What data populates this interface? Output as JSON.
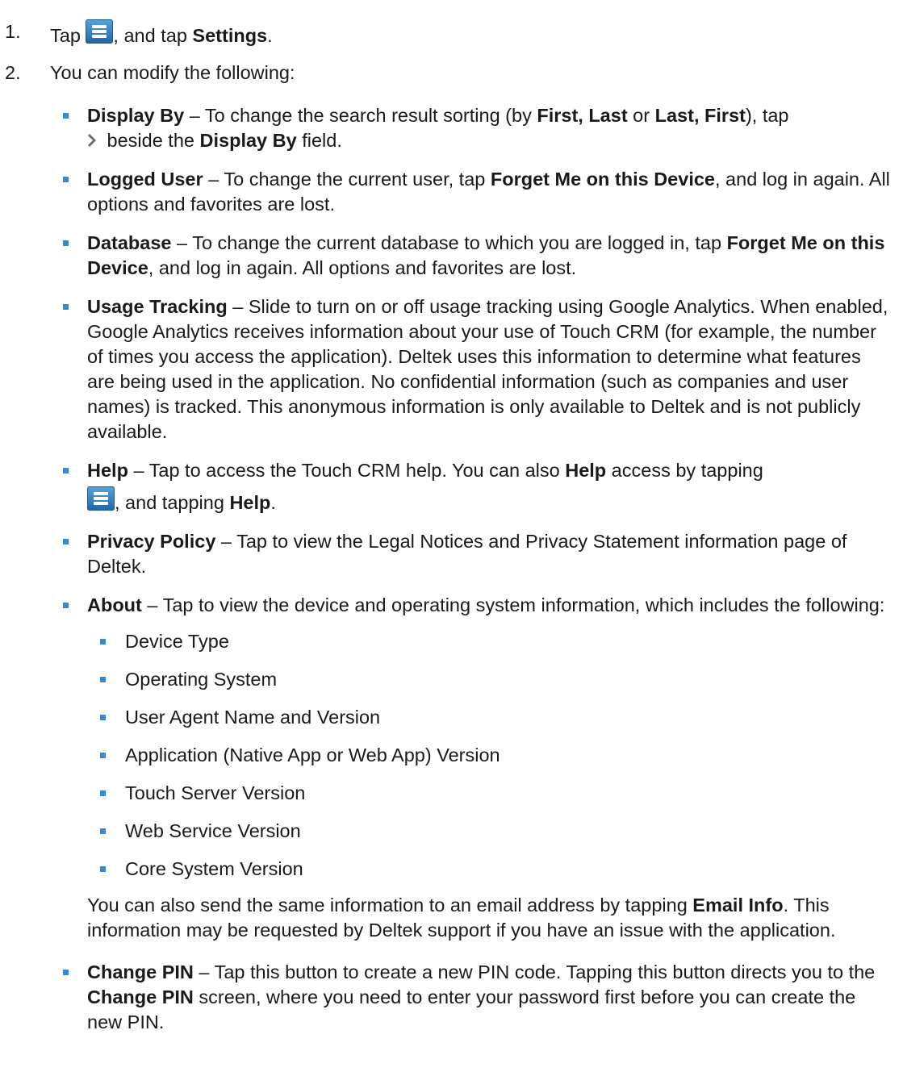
{
  "step1": {
    "num": "1.",
    "pre": "Tap ",
    "post": ", and tap ",
    "bold": "Settings",
    "end": "."
  },
  "step2": {
    "num": "2.",
    "text": "You can modify the following:"
  },
  "display_by": {
    "label": "Display By",
    "t1": " – To change the search result sorting (by ",
    "b1": "First, Last",
    "t2": " or ",
    "b2": "Last, First",
    "t3": "), tap",
    "t4": " beside the ",
    "b3": "Display By",
    "t5": " field."
  },
  "logged_user": {
    "label": "Logged User",
    "t1": " – To change the current user, tap ",
    "b1": "Forget Me on this Device",
    "t2": ", and log in again. All options and favorites are lost."
  },
  "database": {
    "label": "Database",
    "t1": " – To change the current database to which you are logged in, tap ",
    "b1": "Forget Me on this Device",
    "t2": ", and log in again. All options and favorites are lost."
  },
  "usage_tracking": {
    "label": "Usage Tracking",
    "t1": " – Slide to turn on or off usage tracking using Google Analytics. When enabled, Google Analytics receives information about your use of Touch CRM (for example, the number of times you access the application). Deltek uses this information to determine what features are being used in the application. No confidential information (such as companies and user names) is tracked. This anonymous information is only available to Deltek and is not publicly available."
  },
  "help": {
    "label": "Help",
    "t1": " – Tap to access the Touch CRM help. You can also ",
    "b1": "Help",
    "t2": " access by tapping",
    "t3": ", and tapping ",
    "b2": "Help",
    "t4": "."
  },
  "privacy": {
    "label": "Privacy Policy",
    "t1": " – Tap to view the Legal Notices and Privacy Statement information page of Deltek."
  },
  "about": {
    "label": "About",
    "t1": " – Tap to view the device and operating system information, which includes the following:",
    "items": [
      "Device Type",
      "Operating System",
      "User Agent Name and Version",
      "Application (Native App or Web App) Version",
      "Touch Server Version",
      "Web Service Version",
      "Core System Version"
    ],
    "p1": "You can also send the same information to an email address by tapping ",
    "pb": "Email Info",
    "p2": ". This information may be requested by Deltek support if you have an issue with the application."
  },
  "change_pin": {
    "label": "Change PIN",
    "t1": " – Tap this button to create a new PIN code. Tapping this button directs you to the ",
    "b1": "Change PIN",
    "t2": " screen, where you need to enter your password first before you can create the new PIN."
  },
  "icons": {
    "menu": "menu-icon",
    "chevron": "chevron-right-icon"
  },
  "colors": {
    "bullet": "#3f87c8",
    "menu_icon": "#2a78c0"
  }
}
